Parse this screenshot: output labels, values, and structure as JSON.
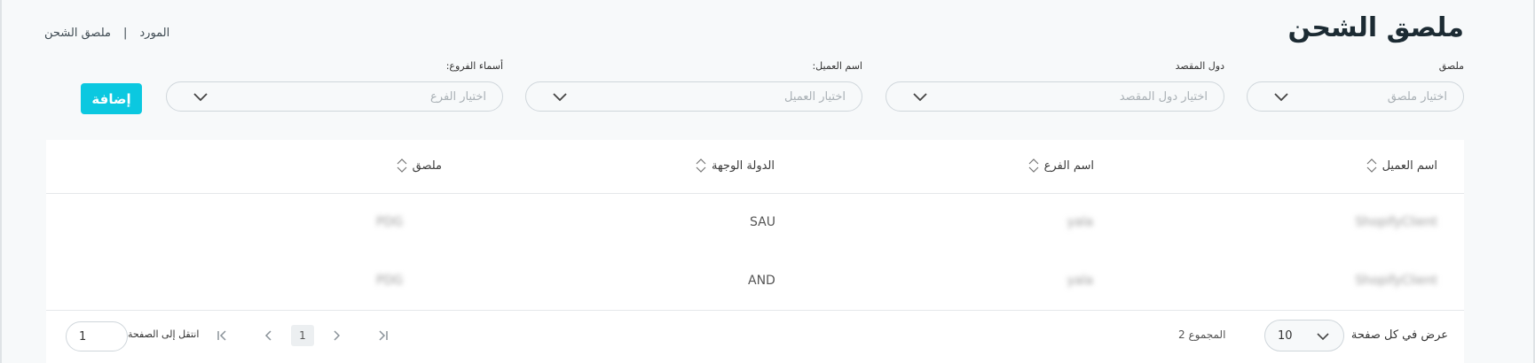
{
  "header": {
    "title": "ملصق الشحن",
    "breadcrumb": [
      "المورد",
      "ملصق الشحن"
    ],
    "breadcrumb_separator": "|"
  },
  "filters": [
    {
      "label": "ملصق",
      "placeholder": "اختيار ملصق"
    },
    {
      "label": "دول المقصد",
      "placeholder": "اختيار دول المقصد"
    },
    {
      "label": "اسم العميل:",
      "placeholder": "اختيار العميل"
    },
    {
      "label": "أسماء الفروع:",
      "placeholder": "اختيار الفرع"
    }
  ],
  "add_button": "إضافة",
  "table": {
    "columns": [
      "اسم العميل",
      "اسم الفرع",
      "الدولة الوجهة",
      "ملصق"
    ],
    "rows": [
      [
        "ShopifyClient",
        "yala",
        "SAU",
        "PDG"
      ],
      [
        "ShopifyClient",
        "yala",
        "AND",
        "PDG"
      ]
    ]
  },
  "pagination": {
    "per_page_label": "عرض في كل صفحة",
    "per_page_value": "10",
    "total_label": "المجموع 2",
    "current_page": "1",
    "goto_label": "انتقل إلى الصفحة",
    "goto_value": "1"
  },
  "colors": {
    "accent": "#0bc8e0",
    "title": "#1c2b33",
    "background": "#f7f9fa"
  }
}
